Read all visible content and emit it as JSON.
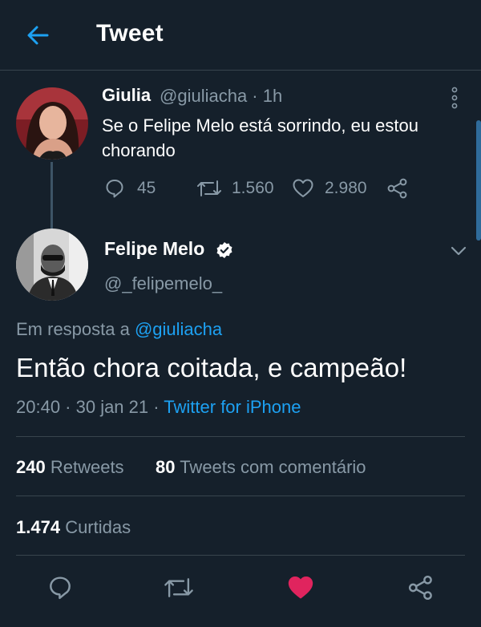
{
  "header": {
    "title": "Tweet"
  },
  "parent_tweet": {
    "name": "Giulia",
    "handle_time": "@giuliacha · 1h",
    "text": "Se o Felipe Melo está sorrindo, eu estou chorando",
    "replies": "45",
    "retweets": "1.560",
    "likes": "2.980"
  },
  "tweet": {
    "name": "Felipe Melo",
    "handle": "@_felipemelo_",
    "reply_prefix": "Em resposta a ",
    "reply_to": "@giuliacha",
    "text": "Então chora coitada, e campeão!",
    "time": "20:40 · 30 jan 21 · ",
    "source": "Twitter for iPhone",
    "retweets_count": "240",
    "retweets_label": "Retweets",
    "quotes_count": "80",
    "quotes_label": "Tweets com comentário",
    "likes_count": "1.474",
    "likes_label": "Curtidas",
    "liked": true
  },
  "colors": {
    "background": "#15202b",
    "accent": "#1da1f2",
    "muted": "#8899a6",
    "like": "#e0245e"
  },
  "icons": [
    "back-arrow-icon",
    "more-vertical-icon",
    "reply-icon",
    "retweet-icon",
    "heart-icon",
    "share-icon",
    "verified-badge-icon",
    "chevron-down-icon"
  ]
}
